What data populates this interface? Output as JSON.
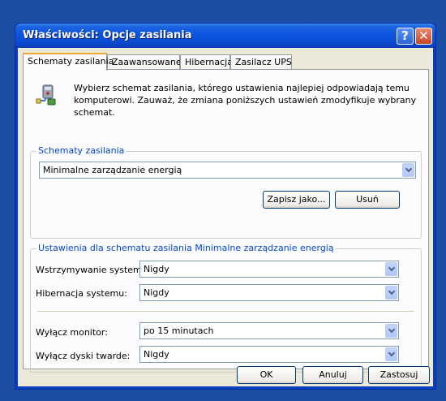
{
  "window": {
    "title": "Właściwości: Opcje zasilania",
    "help_glyph": "?",
    "close_glyph": "✕"
  },
  "tabs": [
    {
      "label": "Schematy zasilania",
      "active": true
    },
    {
      "label": "Zaawansowane",
      "active": false
    },
    {
      "label": "Hibernacja",
      "active": false
    },
    {
      "label": "Zasilacz UPS",
      "active": false
    }
  ],
  "intro": "Wybierz schemat zasilania, którego ustawienia najlepiej odpowiadają temu komputerowi. Zauważ, że zmiana poniższych ustawień zmodyfikuje wybrany schemat.",
  "schemes_group": {
    "legend": "Schematy zasilania",
    "selected": "Minimalne zarządzanie energią",
    "save_as_label": "Zapisz jako...",
    "delete_label": "Usuń"
  },
  "settings_group": {
    "legend": "Ustawienia dla schematu zasilania Minimalne zarządzanie energią",
    "standby_label": "Wstrzymywanie systemu:",
    "standby_value": "Nigdy",
    "hibernate_label": "Hibernacja systemu:",
    "hibernate_value": "Nigdy",
    "monitor_label": "Wyłącz monitor:",
    "monitor_value": "po 15 minutach",
    "disks_label": "Wyłącz dyski twarde:",
    "disks_value": "Nigdy"
  },
  "footer": {
    "ok_label": "OK",
    "cancel_label": "Anuluj",
    "apply_label": "Zastosuj"
  },
  "colors": {
    "desktop": "#1c4ea5",
    "titlebar": "#0b54dd",
    "dialog_face": "#ece9d8",
    "group_legend": "#0046d5",
    "active_tab_accent": "#f0a830"
  },
  "icons": {
    "dialog_icon": "power-options-icon",
    "dropdown_arrow": "chevron-down-icon"
  }
}
